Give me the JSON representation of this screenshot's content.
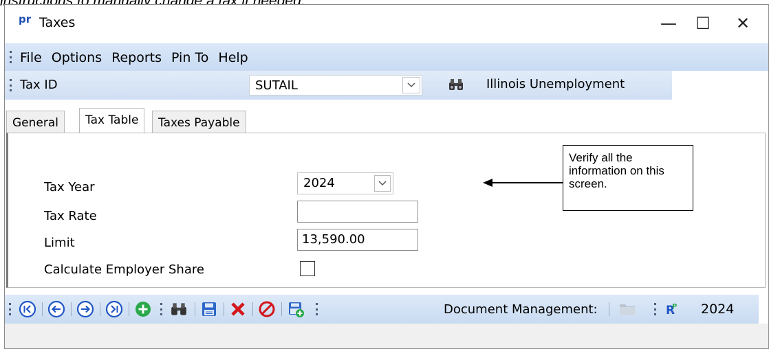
{
  "doc_text": "instructions to manually change a tax if needed.",
  "window": {
    "logo": "pr",
    "title": "Taxes",
    "minimize_glyph": "—",
    "maximize_glyph": "☐",
    "close_glyph": "✕"
  },
  "menu": {
    "items": [
      "File",
      "Options",
      "Reports",
      "Pin To",
      "Help"
    ]
  },
  "taxbar": {
    "label": "Tax ID",
    "value": "SUTAIL",
    "tax_name": "Illinois Unemployment"
  },
  "tabs": [
    {
      "label": "General",
      "active": false
    },
    {
      "label": "Tax Table",
      "active": true
    },
    {
      "label": "Taxes Payable",
      "active": false
    }
  ],
  "form": {
    "tax_year_label": "Tax Year",
    "tax_year_value": "2024",
    "tax_rate_label": "Tax Rate",
    "tax_rate_value": "",
    "limit_label": "Limit",
    "limit_value": "13,590.00",
    "employer_share_label": "Calculate Employer Share",
    "employer_share_checked": false
  },
  "callout": {
    "text": "Verify all the information on this screen."
  },
  "toolbar": {
    "icons": [
      "first-record-icon",
      "previous-record-icon",
      "next-record-icon",
      "last-record-icon",
      "add-icon",
      "binoculars-icon",
      "save-icon",
      "delete-icon",
      "cancel-icon",
      "new-from-icon"
    ],
    "doc_mgmt_label": "Document Management:",
    "year": "2024"
  },
  "colors": {
    "accent_blue": "#1f56c4",
    "toolbar_bg": "#cfdff3",
    "delete_red": "#d4151b",
    "add_green": "#2aa84a"
  }
}
